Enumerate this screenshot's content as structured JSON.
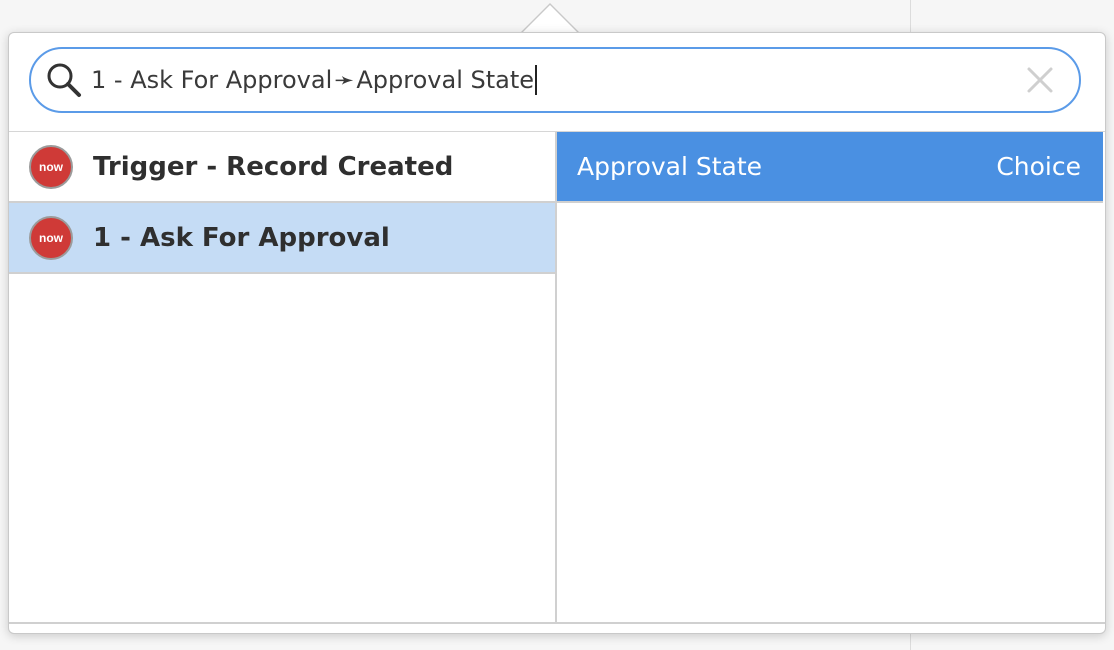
{
  "search": {
    "path_step": "1 - Ask For Approval",
    "path_separator": "➛",
    "path_field": "Approval State"
  },
  "tree": {
    "items": [
      {
        "icon": "now-icon",
        "icon_text": "now",
        "label": "Trigger - Record Created",
        "selected": false
      },
      {
        "icon": "now-icon",
        "icon_text": "now",
        "label": "1 - Ask For Approval",
        "selected": true
      }
    ]
  },
  "fields": {
    "items": [
      {
        "name": "Approval State",
        "type": "Choice",
        "selected": true
      }
    ]
  },
  "colors": {
    "accent": "#4a90e2",
    "search_border": "#5b9be8",
    "selected_row": "#c5dcf5",
    "now_icon": "#cf3a37"
  }
}
